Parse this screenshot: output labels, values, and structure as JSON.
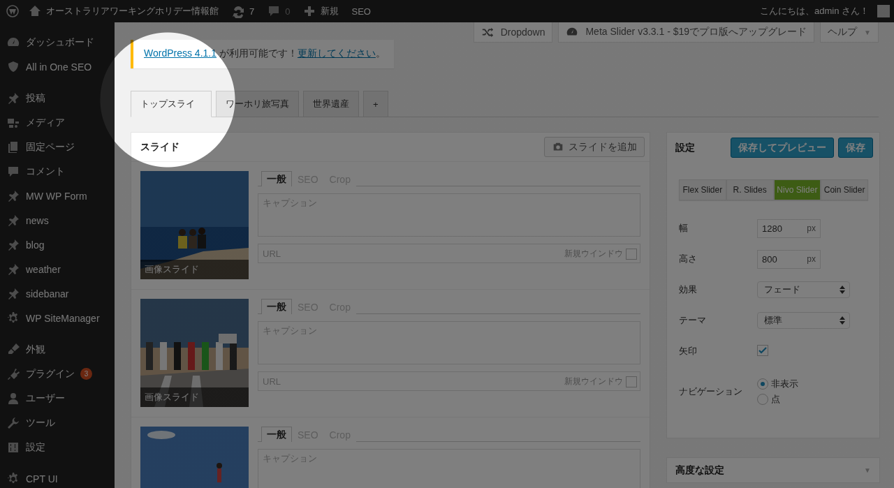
{
  "spotlight": {
    "on": true
  },
  "admin_bar": {
    "site_name": "オーストラリアワーキングホリデー情報館",
    "updates": "7",
    "comments": "0",
    "new_label": "新規",
    "seo_label": "SEO",
    "greeting": "こんにちは、admin さん！"
  },
  "sidebar": {
    "groups": [
      {
        "items": [
          {
            "label": "ダッシュボード"
          },
          {
            "label": "All in One SEO"
          }
        ]
      },
      {
        "items": [
          {
            "label": "投稿"
          },
          {
            "label": "メディア"
          },
          {
            "label": "固定ページ"
          },
          {
            "label": "コメント"
          },
          {
            "label": "MW WP Form"
          },
          {
            "label": "news"
          },
          {
            "label": "blog"
          },
          {
            "label": "weather"
          },
          {
            "label": "sidebanar"
          },
          {
            "label": "WP SiteManager"
          }
        ]
      },
      {
        "items": [
          {
            "label": "外観"
          },
          {
            "label": "プラグイン",
            "badge": "3"
          },
          {
            "label": "ユーザー"
          },
          {
            "label": "ツール"
          },
          {
            "label": "設定"
          }
        ]
      },
      {
        "items": [
          {
            "label": "CPT UI"
          }
        ]
      }
    ]
  },
  "screen_meta": [
    {
      "label": "Dropdown"
    },
    {
      "label": "Meta Slider v3.3.1 - $19でプロ版へアップグレード"
    },
    {
      "label": "ヘルプ",
      "caret": "▼"
    }
  ],
  "notice": {
    "link": "WordPress 4.1.1",
    "text": " が利用可能です！",
    "action": "更新してください",
    "end": "。"
  },
  "slider_tabs": [
    {
      "label": "トップスライ",
      "selected": true
    },
    {
      "label": "ワーホリ旅写真",
      "selected": false
    },
    {
      "label": "世界遺産",
      "selected": false
    },
    {
      "label": "+",
      "selected": false
    }
  ],
  "slides_panel": {
    "title": "スライド",
    "add_button": "スライドを追加",
    "slides": [
      {
        "kind": "picture",
        "type_label": "画像スライド",
        "tabs": [
          {
            "label": "一般",
            "selected": true
          },
          {
            "label": "SEO",
            "selected": false
          },
          {
            "label": "Crop",
            "selected": false
          }
        ],
        "caption_placeholder": "キャプション",
        "url_placeholder": "URL",
        "new_window": "新規ウインドウ",
        "new_window_checked": false
      },
      {
        "kind": "picture",
        "type_label": "画像スライド",
        "tabs": [
          {
            "label": "一般",
            "selected": true
          },
          {
            "label": "SEO",
            "selected": false
          },
          {
            "label": "Crop",
            "selected": false
          }
        ],
        "caption_placeholder": "キャプション",
        "url_placeholder": "URL",
        "new_window": "新規ウインドウ",
        "new_window_checked": false
      },
      {
        "kind": "picture",
        "tabs": [
          {
            "label": "一般",
            "selected": true
          },
          {
            "label": "SEO",
            "selected": false
          },
          {
            "label": "Crop",
            "selected": false
          }
        ],
        "caption_placeholder": "キャプション"
      }
    ]
  },
  "settings": {
    "title": "設定",
    "preview_button": "保存してプレビュー",
    "save_button": "保存",
    "slider_types": [
      {
        "label": "Flex Slider",
        "selected": false
      },
      {
        "label": "R. Slides",
        "selected": false
      },
      {
        "label": "Nivo Slider",
        "selected": true
      },
      {
        "label": "Coin Slider",
        "selected": false
      }
    ],
    "rows": [
      {
        "kind": "number",
        "label": "幅",
        "value": "1280",
        "unit": "px"
      },
      {
        "kind": "number",
        "label": "高さ",
        "value": "800",
        "unit": "px"
      },
      {
        "kind": "select",
        "label": "効果",
        "value": "フェード"
      },
      {
        "kind": "select",
        "label": "テーマ",
        "value": "標準"
      },
      {
        "kind": "checkbox",
        "label": "矢印",
        "checked": true
      },
      {
        "kind": "radio",
        "label": "ナビゲーション",
        "options": [
          {
            "label": "非表示",
            "selected": true
          },
          {
            "label": "点",
            "selected": false
          }
        ]
      }
    ]
  },
  "advanced": {
    "title": "高度な設定",
    "caret": "▼"
  }
}
